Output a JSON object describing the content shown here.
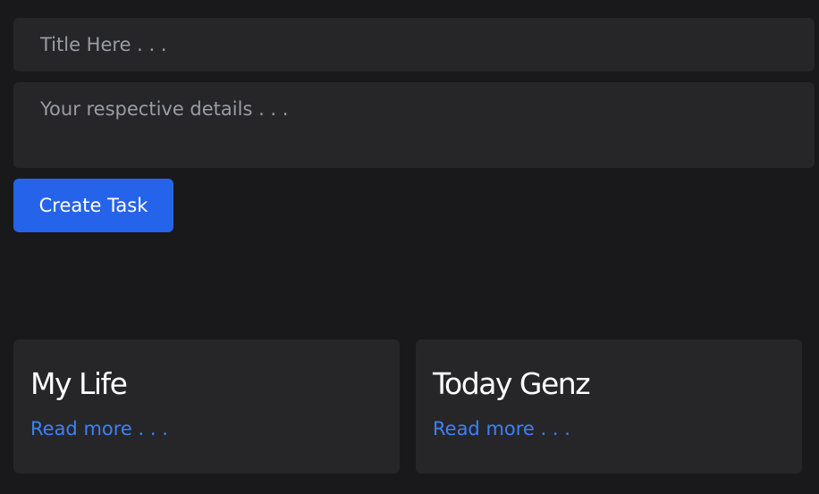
{
  "form": {
    "title_value": "",
    "title_placeholder": "Title Here . . .",
    "details_value": "",
    "details_placeholder": "Your respective details . . .",
    "submit_label": "Create Task",
    "submit_color": "#2563eb"
  },
  "tasks": [
    {
      "title": "My Life",
      "link_label": "Read more . . ."
    },
    {
      "title": "Today Genz",
      "link_label": "Read more . . ."
    }
  ],
  "colors": {
    "background": "#19191b",
    "surface": "#262629",
    "accent": "#2563eb",
    "link": "#3b82f6"
  }
}
